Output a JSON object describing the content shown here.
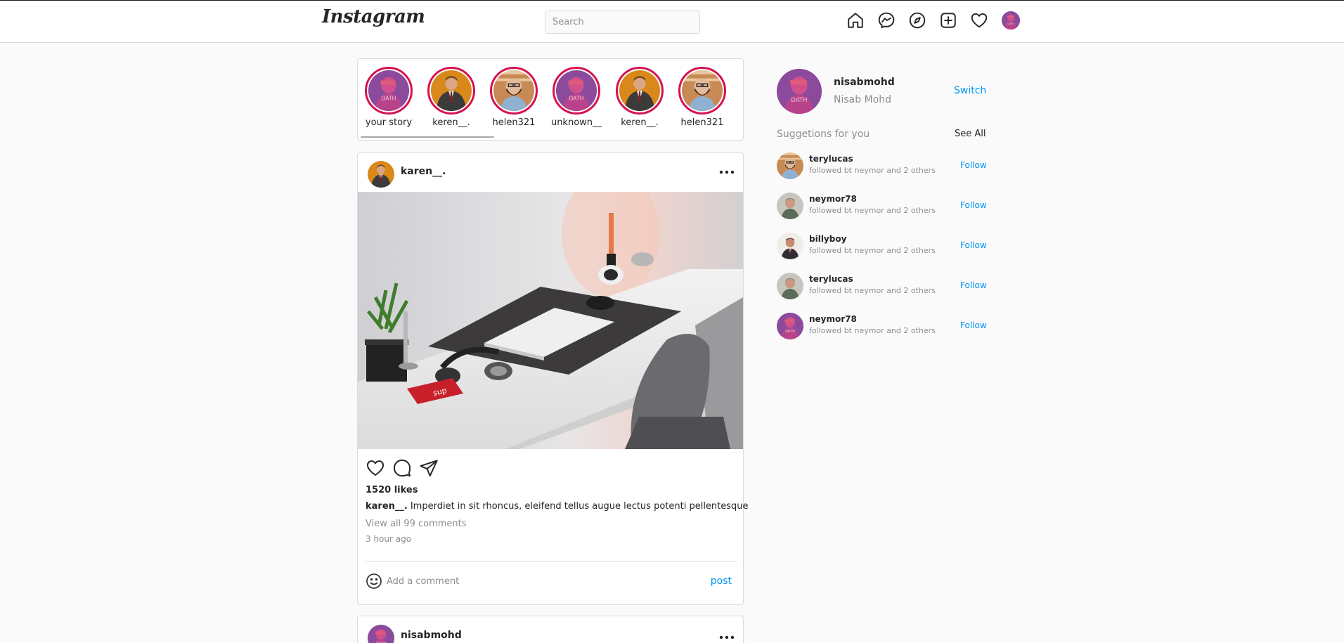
{
  "header": {
    "logo": "Instagram",
    "search_placeholder": "Search",
    "icons": [
      "home-icon",
      "messenger-icon",
      "explore-icon",
      "new-post-icon",
      "activity-heart-icon",
      "profile-avatar"
    ]
  },
  "stories": [
    {
      "name": "your story",
      "avatar": "purple"
    },
    {
      "name": "keren__.",
      "avatar": "orange"
    },
    {
      "name": "helen321",
      "avatar": "beard"
    },
    {
      "name": "unknown__",
      "avatar": "purple"
    },
    {
      "name": "keren__.",
      "avatar": "orange"
    },
    {
      "name": "helen321",
      "avatar": "beard"
    }
  ],
  "post": {
    "username": "karen__.",
    "likes": "1520 likes",
    "caption_user": "karen__.",
    "caption_text": "Imperdiet in sit rhoncus, eleifend tellus augue lectus potenti pellentesque",
    "view_comments": "View all 99 comments",
    "time": "3 hour ago",
    "comment_placeholder": "Add a comment",
    "post_button": "post"
  },
  "post2": {
    "username": "nisabmohd"
  },
  "sidebar": {
    "username": "nisabmohd",
    "fullname": "Nisab Mohd",
    "switch_label": "Switch",
    "suggestions_title": "Suggetions for you",
    "see_all": "See All",
    "follow_label": "Follow",
    "suggestions": [
      {
        "username": "terylucas",
        "subtitle": "followed bt neymor and 2 others",
        "avatar": "beard"
      },
      {
        "username": "neymor78",
        "subtitle": "followed bt neymor and 2 others",
        "avatar": "grey"
      },
      {
        "username": "billyboy",
        "subtitle": "followed bt neymor and 2 others",
        "avatar": "suit"
      },
      {
        "username": "terylucas",
        "subtitle": "followed bt neymor and 2 others",
        "avatar": "grey"
      },
      {
        "username": "neymor78",
        "subtitle": "followed bt neymor and 2 others",
        "avatar": "purple"
      }
    ]
  },
  "colors": {
    "story_ring": "#d6124f",
    "link_blue": "#0095f6",
    "border": "#dbdbdb",
    "background": "#fafafa"
  }
}
